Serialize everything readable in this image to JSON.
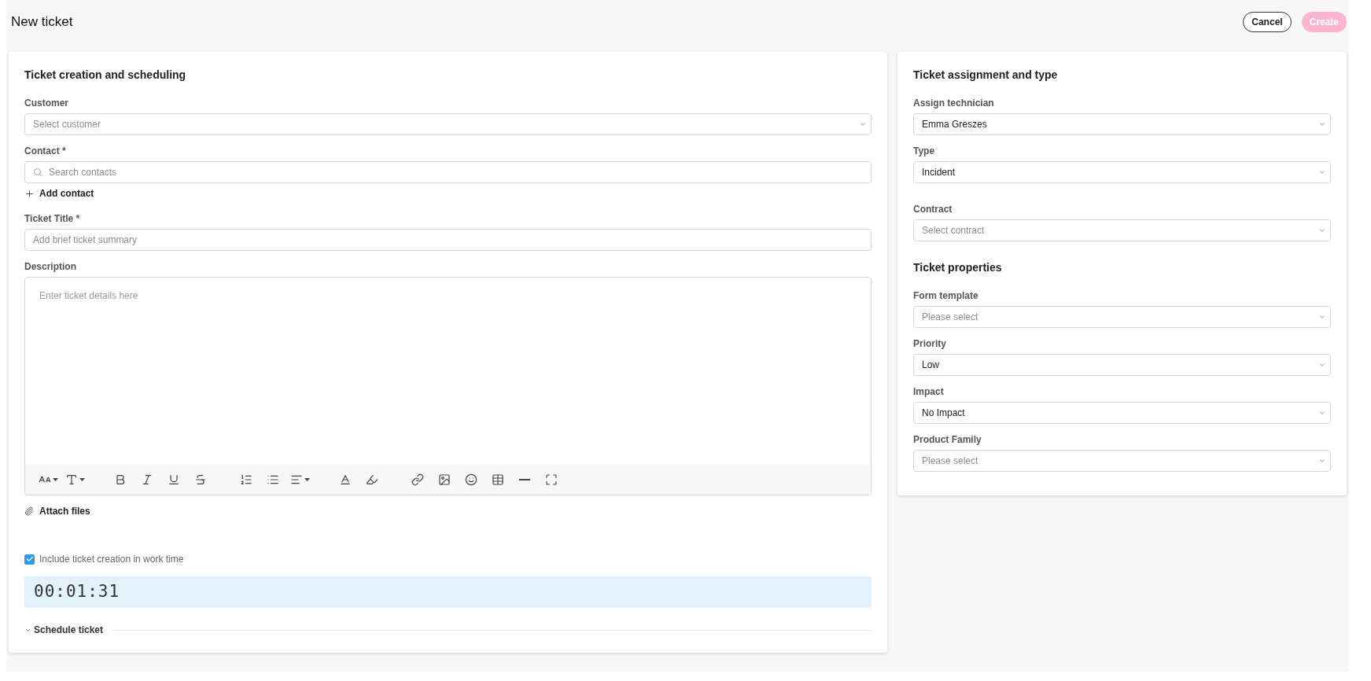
{
  "header": {
    "title": "New ticket",
    "buttons": [
      {
        "label": "Cancel",
        "kind": "outline",
        "disabled": false
      },
      {
        "label": "Create",
        "kind": "primary",
        "disabled": true
      }
    ]
  },
  "creation": {
    "title": "Ticket creation and scheduling",
    "fields": [
      {
        "kind": "select",
        "label": "Customer",
        "placeholder": "Select customer"
      },
      {
        "kind": "search",
        "label": "Contact *",
        "placeholder": "Search contacts",
        "action": "Add contact"
      },
      {
        "kind": "text",
        "label": "Ticket Title *",
        "placeholder": "Add brief ticket summary"
      },
      {
        "kind": "editor",
        "label": "Description",
        "placeholder": "Enter ticket details here"
      }
    ],
    "attach": "Attach files",
    "work_time": {
      "label": "Include ticket creation in work time",
      "checked": true
    },
    "timer": "00:01:31",
    "schedule": {
      "label": "Schedule ticket",
      "expanded": false
    }
  },
  "assignment": {
    "sections": [
      {
        "title": "Ticket assignment and type",
        "fields": [
          {
            "kind": "select",
            "label": "Assign technician",
            "value": "Emma Greszes"
          },
          {
            "kind": "select",
            "label": "Type",
            "value": "Incident"
          },
          {
            "kind": "select",
            "label": "Contract",
            "placeholder": "Select contract"
          }
        ]
      },
      {
        "title": "Ticket properties",
        "fields": [
          {
            "kind": "select",
            "label": "Form template",
            "placeholder": "Please select"
          },
          {
            "kind": "select",
            "label": "Priority",
            "value": "Low"
          },
          {
            "kind": "select",
            "label": "Impact",
            "value": "No Impact"
          },
          {
            "kind": "select",
            "label": "Product Family",
            "placeholder": "Please select"
          }
        ]
      }
    ]
  }
}
